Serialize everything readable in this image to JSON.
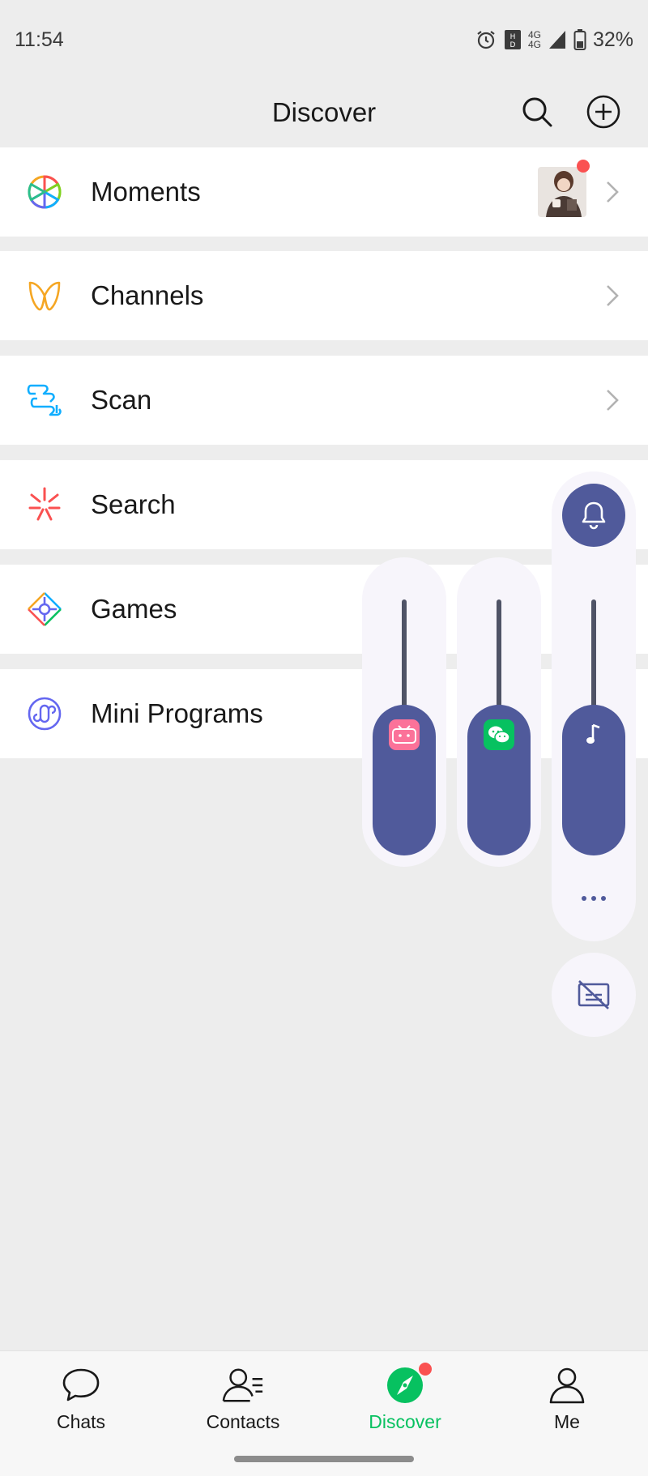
{
  "status_bar": {
    "time": "11:54",
    "network": "4G",
    "battery": "32%",
    "icons": [
      "alarm-icon",
      "hd-icon",
      "network-4g-icon",
      "signal-icon",
      "battery-icon"
    ]
  },
  "header": {
    "title": "Discover",
    "icons": [
      "search-icon",
      "add-circle-icon"
    ]
  },
  "menu": [
    {
      "label": "Moments",
      "icon": "moments-icon"
    },
    {
      "label": "Channels",
      "icon": "channels-icon"
    },
    {
      "label": "Scan",
      "icon": "scan-icon"
    },
    {
      "label": "Search",
      "icon": "search-spark-icon"
    },
    {
      "label": "Games",
      "icon": "games-icon"
    },
    {
      "label": "Mini Programs",
      "icon": "mini-programs-icon"
    }
  ],
  "volume_panel": {
    "sliders": [
      {
        "app": "bilibili",
        "icon": "bilibili-icon",
        "level": 0.45
      },
      {
        "app": "WeChat",
        "icon": "wechat-icon",
        "level": 0.45
      },
      {
        "app": "media",
        "icon": "music-note-icon",
        "level": 0.45
      }
    ],
    "icons": [
      "bell-icon",
      "more-icon",
      "subtitles-off-icon"
    ]
  },
  "tabbar": {
    "tabs": [
      {
        "label": "Chats",
        "icon": "chat-bubble-icon",
        "active": false
      },
      {
        "label": "Contacts",
        "icon": "contacts-icon",
        "active": false
      },
      {
        "label": "Discover",
        "icon": "compass-icon",
        "active": true
      },
      {
        "label": "Me",
        "icon": "person-icon",
        "active": false
      }
    ]
  },
  "colors": {
    "accent": "#07c160",
    "badge": "#fa5151",
    "volume_fill": "#505a9b",
    "background": "#ededed"
  }
}
